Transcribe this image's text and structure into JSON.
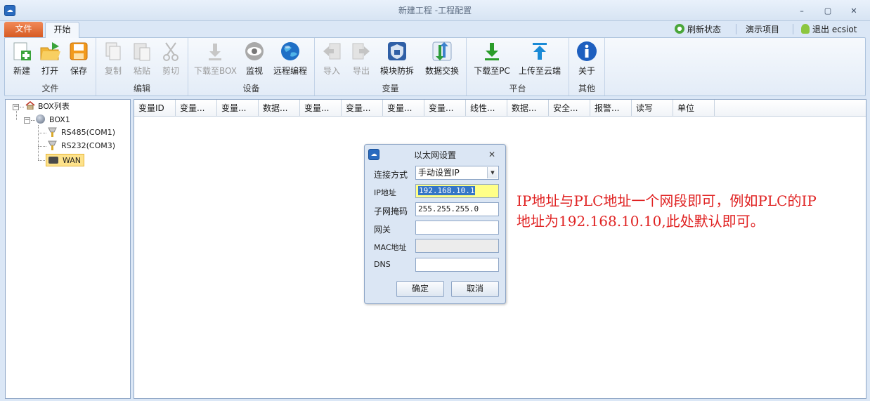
{
  "window": {
    "title": "新建工程 -工程配置",
    "app_icon": "cloud-logo-icon",
    "minimize": "–",
    "maximize": "▢",
    "close": "✕"
  },
  "tabs": {
    "file": "文件",
    "start": "开始"
  },
  "quick_actions": [
    {
      "label": "刷新状态",
      "icon": "refresh-icon"
    },
    {
      "label": "演示项目",
      "icon": ""
    },
    {
      "label": "退出 ecsiot",
      "icon": "user-icon"
    }
  ],
  "ribbon": {
    "groups": [
      {
        "label": "文件",
        "buttons": [
          {
            "label": "新建",
            "icon": "new-file-icon"
          },
          {
            "label": "打开",
            "icon": "open-folder-icon"
          },
          {
            "label": "保存",
            "icon": "save-icon"
          }
        ]
      },
      {
        "label": "编辑",
        "buttons": [
          {
            "label": "复制",
            "icon": "copy-icon"
          },
          {
            "label": "粘贴",
            "icon": "paste-icon"
          },
          {
            "label": "剪切",
            "icon": "cut-icon"
          }
        ]
      },
      {
        "label": "设备",
        "buttons": [
          {
            "label": "下载至BOX",
            "icon": "download-icon"
          },
          {
            "label": "监视",
            "icon": "eye-icon"
          },
          {
            "label": "远程编程",
            "icon": "globe-icon"
          }
        ]
      },
      {
        "label": "变量",
        "buttons": [
          {
            "label": "导入",
            "icon": "import-icon"
          },
          {
            "label": "导出",
            "icon": "export-icon"
          },
          {
            "label": "模块防拆",
            "icon": "shield-lock-icon"
          },
          {
            "label": "数据交换",
            "icon": "exchange-icon"
          }
        ]
      },
      {
        "label": "平台",
        "buttons": [
          {
            "label": "下载至PC",
            "icon": "download-green-icon"
          },
          {
            "label": "上传至云端",
            "icon": "upload-cloud-icon"
          }
        ]
      },
      {
        "label": "其他",
        "buttons": [
          {
            "label": "关于",
            "icon": "info-icon"
          }
        ]
      }
    ]
  },
  "tree": {
    "root": "BOX列表",
    "box": "BOX1",
    "children": [
      "RS485(COM1)",
      "RS232(COM3)",
      "WAN"
    ]
  },
  "grid": {
    "columns": [
      "变量ID",
      "变量...",
      "变量...",
      "数据...",
      "变量...",
      "变量...",
      "变量...",
      "变量...",
      "线性...",
      "数据...",
      "安全...",
      "报警...",
      "读写",
      "单位"
    ]
  },
  "dialog": {
    "title": "以太网设置",
    "close": "✕",
    "fields": [
      {
        "label": "连接方式",
        "value": "手动设置IP"
      },
      {
        "label": "IP地址",
        "value": "192.168.10.1"
      },
      {
        "label": "子网掩码",
        "value": "255.255.255.0"
      },
      {
        "label": "网关",
        "value": ""
      },
      {
        "label": "MAC地址",
        "value": ""
      },
      {
        "label": "DNS",
        "value": ""
      }
    ],
    "ok": "确定",
    "cancel": "取消"
  },
  "annotation": {
    "line1": "IP地址与PLC地址一个网段即可，例如PLC的IP",
    "line2": "地址为192.168.10.10,此处默认即可。",
    "color": "#e02323"
  }
}
